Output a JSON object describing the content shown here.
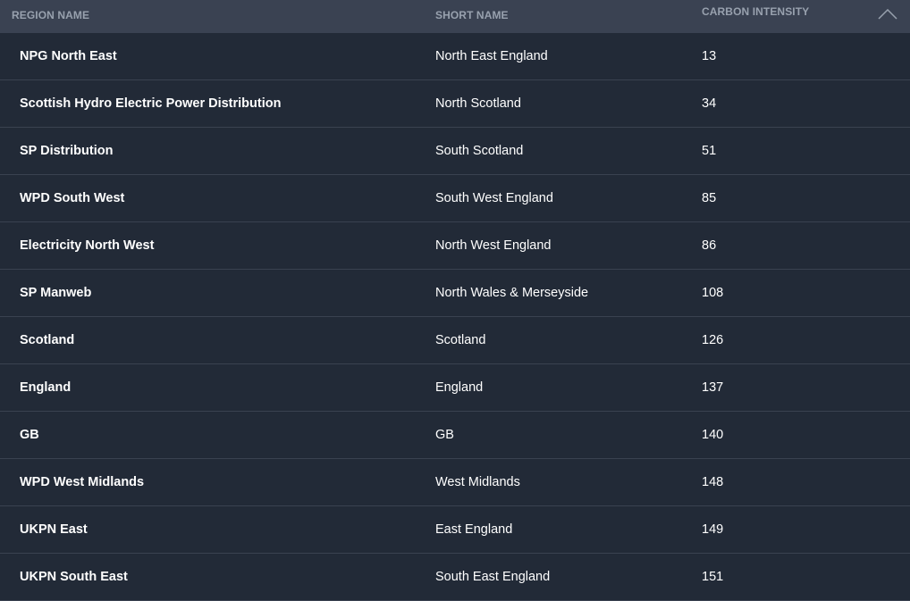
{
  "table": {
    "headers": [
      "REGION NAME",
      "SHORT NAME",
      "CARBON INTENSITY"
    ],
    "sort_icon": "chevron-up-icon",
    "rows": [
      [
        "NPG North East",
        "North East England",
        "13"
      ],
      [
        "Scottish Hydro Electric Power Distribution",
        "North Scotland",
        "34"
      ],
      [
        "SP Distribution",
        "South Scotland",
        "51"
      ],
      [
        "WPD South West",
        "South West England",
        "85"
      ],
      [
        "Electricity North West",
        "North West England",
        "86"
      ],
      [
        "SP Manweb",
        "North Wales & Merseyside",
        "108"
      ],
      [
        "Scotland",
        "Scotland",
        "126"
      ],
      [
        "England",
        "England",
        "137"
      ],
      [
        "GB",
        "GB",
        "140"
      ],
      [
        "WPD West Midlands",
        "West Midlands",
        "148"
      ],
      [
        "UKPN East",
        "East England",
        "149"
      ],
      [
        "UKPN South East",
        "South East England",
        "151"
      ]
    ]
  },
  "colors": {
    "header_bg": "#3a4252",
    "row_bg": "#222a37",
    "header_text": "#98a1ae",
    "text": "#ffffff"
  }
}
